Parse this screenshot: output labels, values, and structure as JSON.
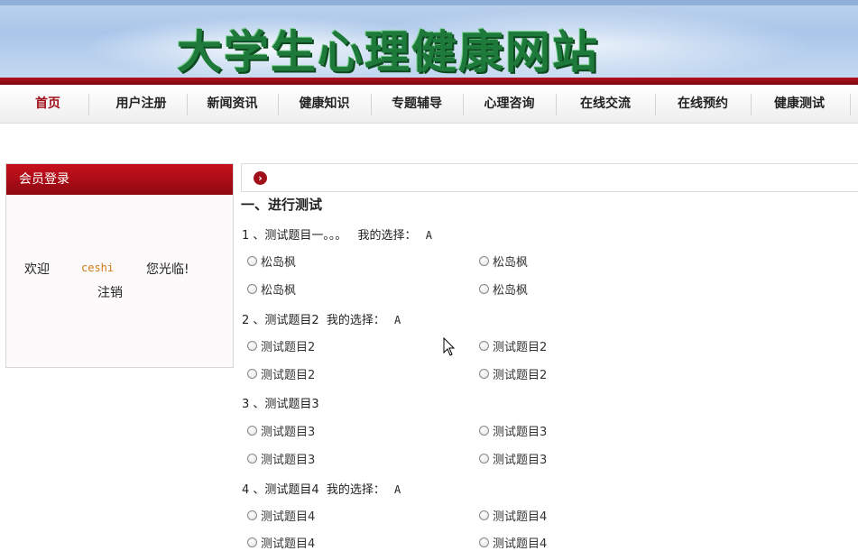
{
  "site": {
    "title": "大学生心理健康网站"
  },
  "nav": {
    "items": [
      "首页",
      "用户注册",
      "新闻资讯",
      "健康知识",
      "专题辅导",
      "心理咨询",
      "在线交流",
      "在线预约",
      "健康测试"
    ],
    "active_index": 0
  },
  "login_panel": {
    "header": "会员登录",
    "welcome": "欢迎",
    "username": "ceshi",
    "greeting_tail": "您光临!",
    "logout": "注销"
  },
  "content": {
    "section_title": "一、进行测试",
    "questions": [
      {
        "label": "1 、测试题目一。。。",
        "choice_label": "我的选择：",
        "choice": "A",
        "options": [
          "松岛枫",
          "松岛枫",
          "松岛枫",
          "松岛枫"
        ]
      },
      {
        "label": "2 、测试题目2",
        "choice_label": "我的选择：",
        "choice": "A",
        "options": [
          "测试题目2",
          "测试题目2",
          "测试题目2",
          "测试题目2"
        ]
      },
      {
        "label": "3 、测试题目3",
        "choice_label": "",
        "choice": "",
        "options": [
          "测试题目3",
          "测试题目3",
          "测试题目3",
          "测试题目3"
        ]
      },
      {
        "label": "4 、测试题目4",
        "choice_label": "我的选择：",
        "choice": "A",
        "options": [
          "测试题目4",
          "测试题目4",
          "测试题目4",
          "测试题目4"
        ]
      }
    ]
  },
  "colors": {
    "accent_red": "#a1101a",
    "banner_green": "#1d7a3a",
    "username_orange": "#d37a17"
  },
  "icons": {
    "header_arrow": "chevron-right-circle-icon",
    "cursor": "mouse-pointer-icon"
  }
}
